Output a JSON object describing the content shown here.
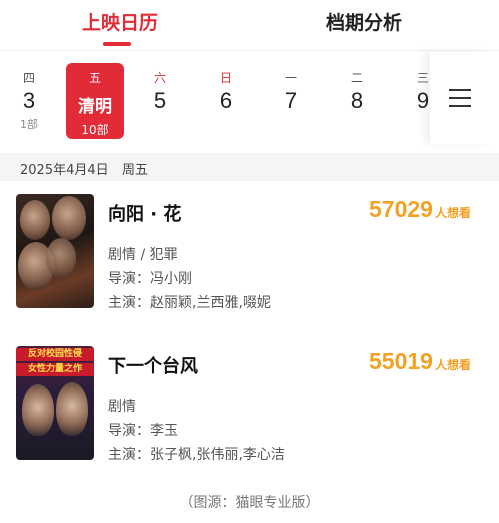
{
  "tabs": {
    "active": "上映日历",
    "other": "档期分析"
  },
  "dates": [
    {
      "weekday": "四",
      "day": "3",
      "count": "1部",
      "selected": false,
      "weekend": false
    },
    {
      "weekday": "五",
      "day": "清明",
      "count": "10部",
      "selected": true,
      "weekend": false
    },
    {
      "weekday": "六",
      "day": "5",
      "count": "",
      "selected": false,
      "weekend": true
    },
    {
      "weekday": "日",
      "day": "6",
      "count": "",
      "selected": false,
      "weekend": true
    },
    {
      "weekday": "一",
      "day": "7",
      "count": "",
      "selected": false,
      "weekend": false
    },
    {
      "weekday": "二",
      "day": "8",
      "count": "",
      "selected": false,
      "weekend": false
    },
    {
      "weekday": "三",
      "day": "9",
      "count": "",
      "selected": false,
      "weekend": false
    }
  ],
  "menu_icon": "hamburger-menu-icon",
  "date_header": {
    "date": "2025年4月4日",
    "weekday": "周五"
  },
  "movies": [
    {
      "title": "向阳 · 花",
      "want_count": "57029",
      "want_unit": "人想看",
      "genre": "剧情 / 犯罪",
      "director": "导演：冯小刚",
      "cast": "主演：赵丽颖,兰西雅,啜妮"
    },
    {
      "title": "下一个台风",
      "want_count": "55019",
      "want_unit": "人想看",
      "genre": "剧情",
      "director": "导演：李玉",
      "cast": "主演：张子枫,张伟丽,李心洁",
      "poster_text": [
        "反对校园性侵",
        "女性力量之作"
      ]
    }
  ],
  "source": "（图源：猫眼专业版）",
  "colors": {
    "accent": "#e12b36",
    "want": "#f3a225"
  }
}
